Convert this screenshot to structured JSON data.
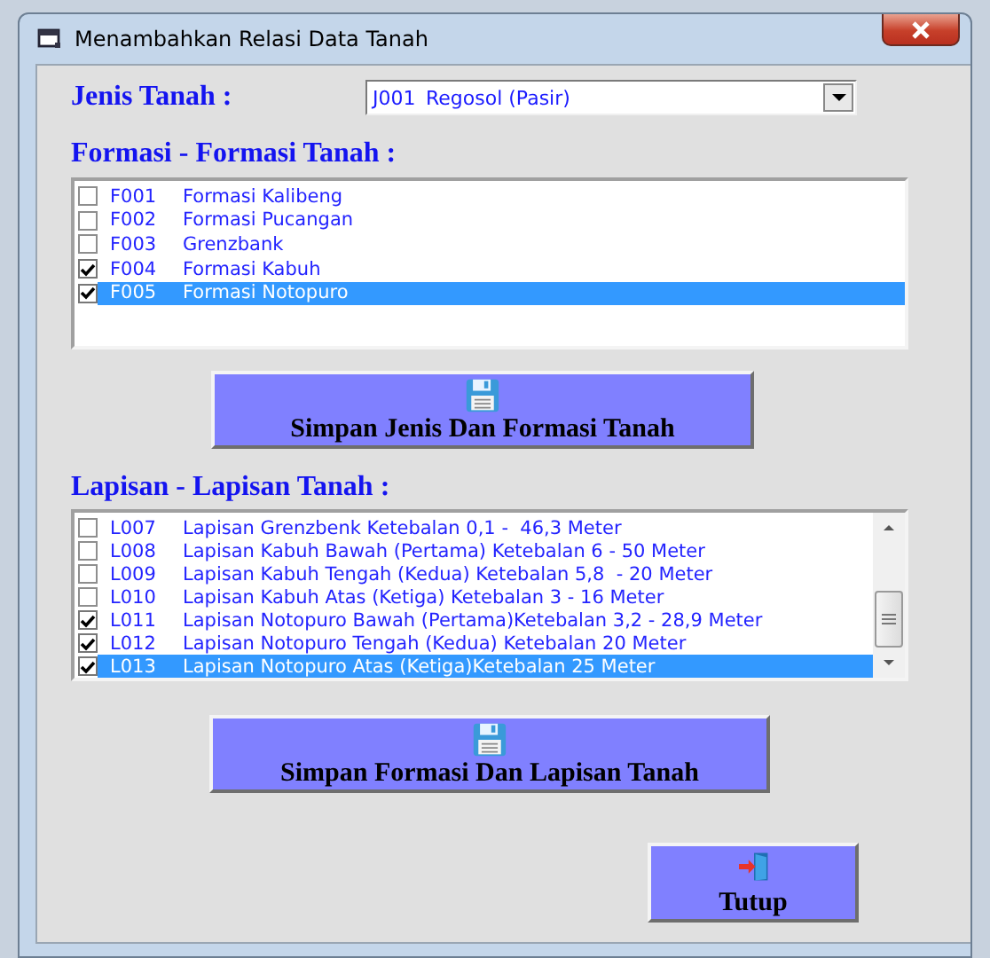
{
  "window": {
    "title": "Menambahkan Relasi Data Tanah"
  },
  "jenis_tanah": {
    "label": "Jenis Tanah :",
    "code": "J001",
    "value": "Regosol (Pasir)"
  },
  "formasi": {
    "label": "Formasi - Formasi Tanah :",
    "items": [
      {
        "code": "F001",
        "name": "Formasi Kalibeng",
        "checked": false,
        "selected": false
      },
      {
        "code": "F002",
        "name": "Formasi Pucangan",
        "checked": false,
        "selected": false
      },
      {
        "code": "F003",
        "name": "Grenzbank",
        "checked": false,
        "selected": false
      },
      {
        "code": "F004",
        "name": "Formasi Kabuh",
        "checked": true,
        "selected": false
      },
      {
        "code": "F005",
        "name": "Formasi Notopuro",
        "checked": true,
        "selected": true
      }
    ]
  },
  "save_formasi_button": {
    "label": "Simpan Jenis Dan Formasi Tanah"
  },
  "lapisan": {
    "label": "Lapisan - Lapisan Tanah :",
    "items": [
      {
        "code": "L007",
        "name": "Lapisan Grenzbenk Ketebalan 0,1 -  46,3 Meter",
        "checked": false,
        "selected": false
      },
      {
        "code": "L008",
        "name": "Lapisan Kabuh Bawah (Pertama) Ketebalan 6 - 50 Meter",
        "checked": false,
        "selected": false
      },
      {
        "code": "L009",
        "name": "Lapisan Kabuh Tengah (Kedua) Ketebalan 5,8  - 20 Meter",
        "checked": false,
        "selected": false
      },
      {
        "code": "L010",
        "name": "Lapisan Kabuh Atas (Ketiga) Ketebalan 3 - 16 Meter",
        "checked": false,
        "selected": false
      },
      {
        "code": "L011",
        "name": "Lapisan Notopuro Bawah (Pertama)Ketebalan 3,2 - 28,9 Meter",
        "checked": true,
        "selected": false
      },
      {
        "code": "L012",
        "name": "Lapisan Notopuro Tengah (Kedua) Ketebalan 20 Meter",
        "checked": true,
        "selected": false
      },
      {
        "code": "L013",
        "name": "Lapisan Notopuro Atas (Ketiga)Ketebalan 25 Meter",
        "checked": true,
        "selected": true
      }
    ]
  },
  "save_lapisan_button": {
    "label": "Simpan Formasi Dan Lapisan Tanah"
  },
  "close_button": {
    "label": "Tutup"
  }
}
